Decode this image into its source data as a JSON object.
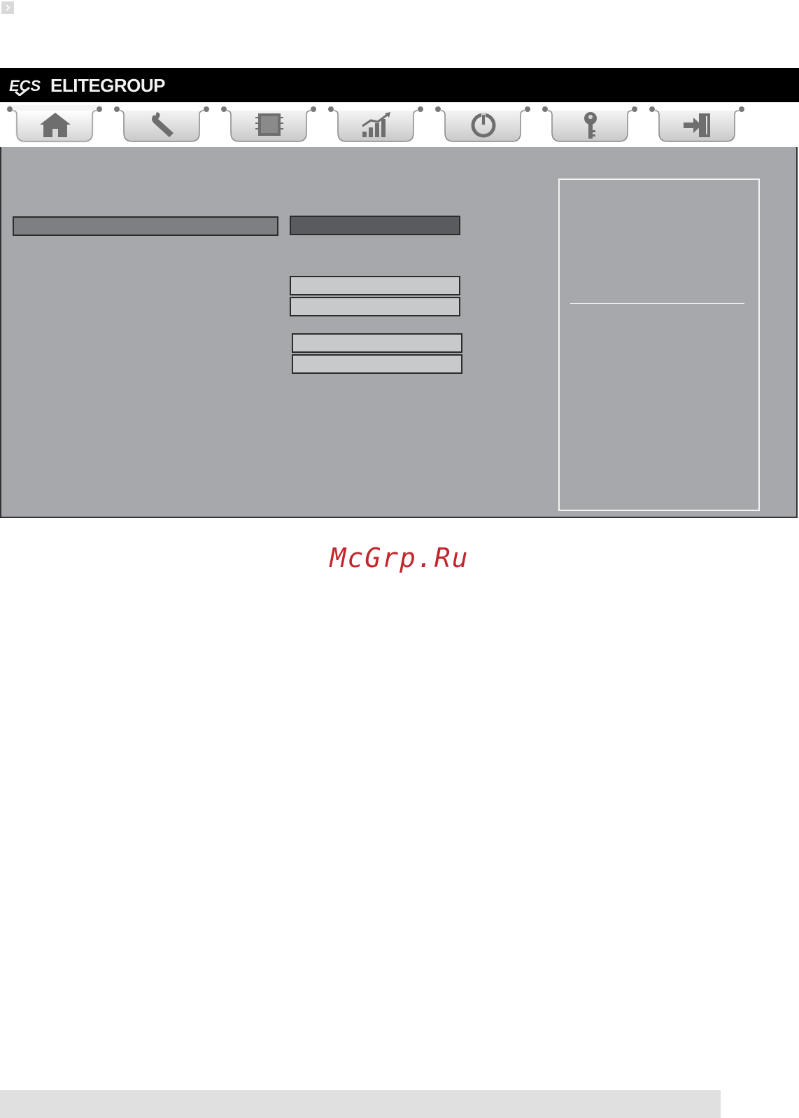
{
  "header": {
    "brand": "ELITEGROUP",
    "logo_text": "ECS"
  },
  "tabs": [
    {
      "icon": "home-icon"
    },
    {
      "icon": "wrench-icon"
    },
    {
      "icon": "chip-icon"
    },
    {
      "icon": "chart-icon"
    },
    {
      "icon": "power-icon"
    },
    {
      "icon": "key-icon"
    },
    {
      "icon": "exit-icon"
    }
  ],
  "watermark": "McGrp.Ru",
  "colors": {
    "topbar": "#000000",
    "panel": "#a7a8ab",
    "selected_bar": "#5a5b5e",
    "left_bar": "#7e7f82",
    "field": "#c8c9cb",
    "watermark": "#c2272d"
  }
}
